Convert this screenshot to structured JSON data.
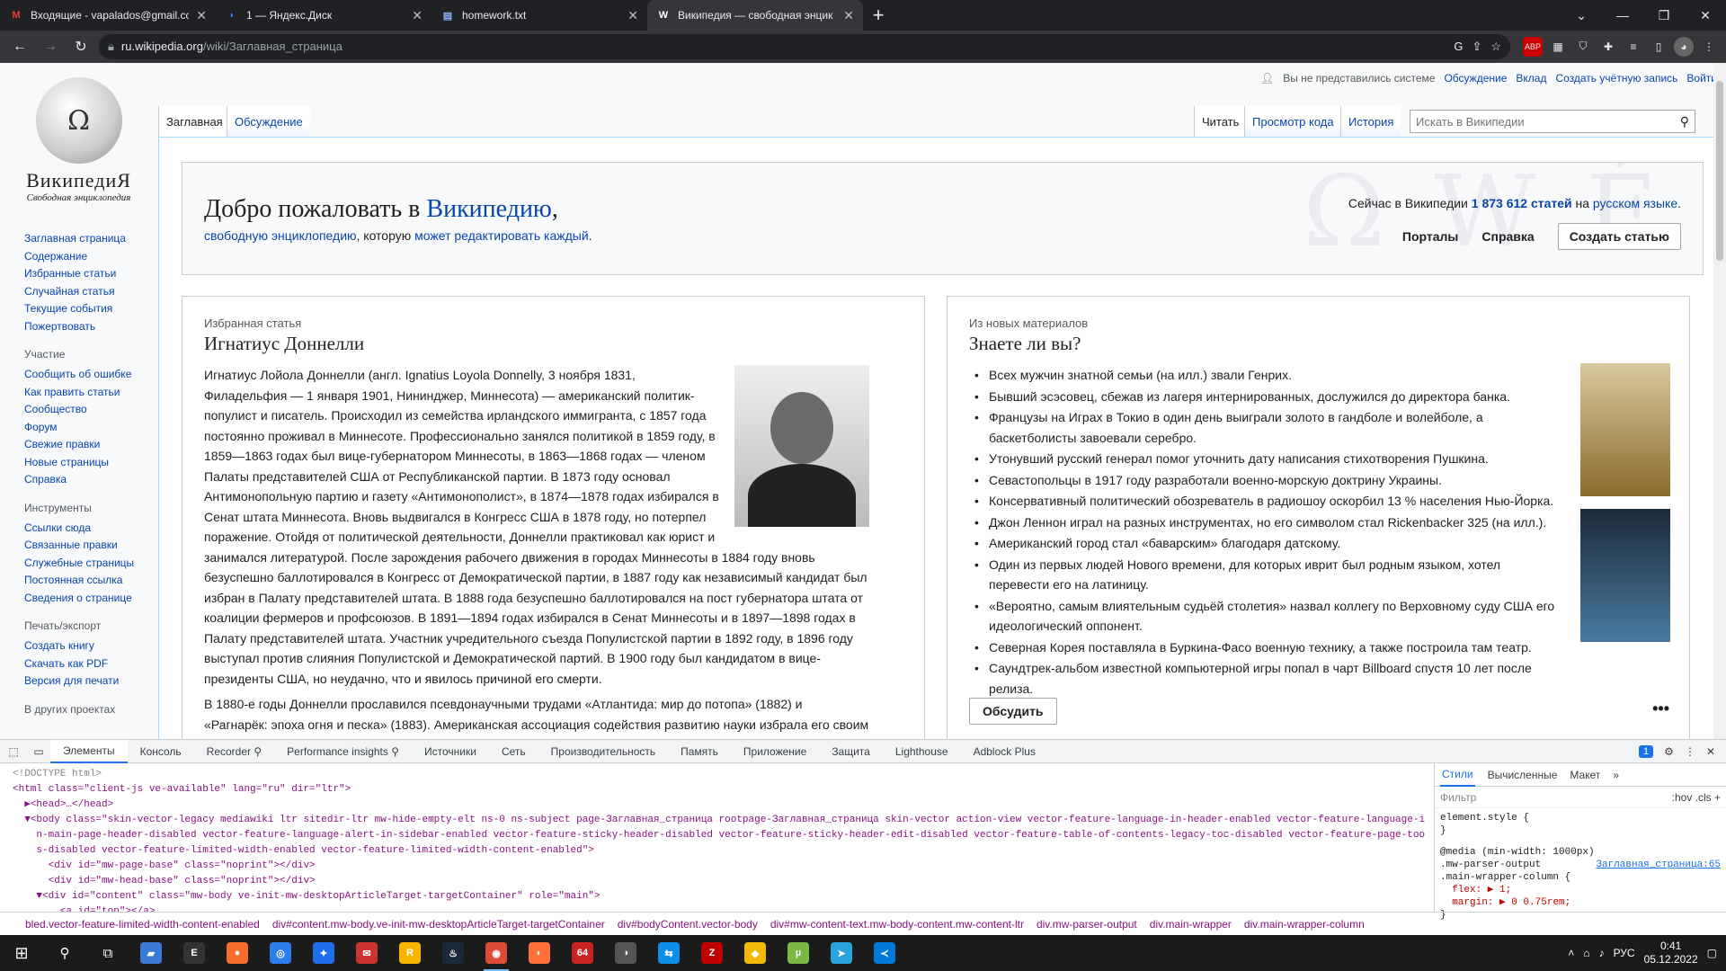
{
  "browser": {
    "tabs": [
      {
        "icon": "gmail-icon",
        "glyph": "M",
        "color": "#ea4335",
        "label": "Входящие - vapalados@gmail.co"
      },
      {
        "icon": "yandex-disk-icon",
        "glyph": "◗",
        "color": "#2f7cf6",
        "label": "1 — Яндекс.Диск"
      },
      {
        "icon": "text-file-icon",
        "glyph": "▤",
        "color": "#8ab4f8",
        "label": "homework.txt"
      },
      {
        "icon": "wikipedia-icon",
        "glyph": "W",
        "color": "#ffffff",
        "label": "Википедия — свободная энцик"
      }
    ],
    "url_host": "ru.wikipedia.org",
    "url_path": "/wiki/Заглавная_страница"
  },
  "wiki": {
    "wordmark": "ВикипедиЯ",
    "tagline": "Свободная энциклопедия",
    "personal": {
      "anon": "Вы не представились системе",
      "links": [
        "Обсуждение",
        "Вклад",
        "Создать учётную запись",
        "Войти"
      ]
    },
    "nav_main": [
      "Заглавная страница",
      "Содержание",
      "Избранные статьи",
      "Случайная статья",
      "Текущие события",
      "Пожертвовать"
    ],
    "nav_participation_head": "Участие",
    "nav_participation": [
      "Сообщить об ошибке",
      "Как править статьи",
      "Сообщество",
      "Форум",
      "Свежие правки",
      "Новые страницы",
      "Справка"
    ],
    "nav_tools_head": "Инструменты",
    "nav_tools": [
      "Ссылки сюда",
      "Связанные правки",
      "Служебные страницы",
      "Постоянная ссылка",
      "Сведения о странице"
    ],
    "nav_print_head": "Печать/экспорт",
    "nav_print": [
      "Создать книгу",
      "Скачать как PDF",
      "Версия для печати"
    ],
    "nav_other_head": "В других проектах",
    "tab_main": "Заглавная",
    "tab_talk": "Обсуждение",
    "tab_read": "Читать",
    "tab_source": "Просмотр кода",
    "tab_history": "История",
    "search_placeholder": "Искать в Википедии",
    "welcome": {
      "title_prefix": "Добро пожаловать в ",
      "title_link": "Википедию",
      "title_suffix": ",",
      "sub_link1": "свободную энциклопедию",
      "sub_mid": ", которую ",
      "sub_link2": "может редактировать каждый",
      "sub_end": ".",
      "stats_prefix": "Сейчас в Википедии ",
      "stats_count": "1 873 612 статей",
      "stats_mid": " на ",
      "stats_lang": "русском языке",
      "stats_end": ".",
      "portals": "Порталы",
      "help": "Справка",
      "create": "Создать статью"
    },
    "featured": {
      "kicker": "Избранная статья",
      "title": "Игнатиус Доннелли",
      "p1": "Игнатиус Лойола Доннелли (англ. Ignatius Loyola Donnelly, 3 ноября 1831, Филадельфия — 1 января 1901, Нининджер, Миннесота) — американский политик-популист и писатель. Происходил из семейства ирландского иммигранта, с 1857 года постоянно проживал в Миннесоте. Профессионально занялся политикой в 1859 году, в 1859—1863 годах был вице-губернатором Миннесоты, в 1863—1868 годах — членом Палаты представителей США от Республиканской партии. В 1873 году основал Антимонопольную партию и газету «Антимонополист», в 1874—1878 годах избирался в Сенат штата Миннесота. Вновь выдвигался в Конгресс США в 1878 году, но потерпел поражение. Отойдя от политической деятельности, Доннелли практиковал как юрист и занимался литературой. После зарождения рабочего движения в городах Миннесоты в 1884 году вновь безуспешно баллотировался в Конгресс от Демократической партии, в 1887 году как независимый кандидат был избран в Палату представителей штата. В 1888 года безуспешно баллотировался на пост губернатора штата от коалиции фермеров и профсоюзов. В 1891—1894 годах избирался в Сенат Миннесоты и в 1897—1898 годах в Палату представителей штата. Участник учредительного съезда Популистской партии в 1892 году, в 1896 году выступал против слияния Популистской и Демократической партий. В 1900 году был кандидатом в вице-президенты США, но неудачно, что и явилось причиной его смерти.",
      "p2": "В 1880-е годы Доннелли прославился псевдонаучными трудами «Атлантида: мир до потопа» (1882) и «Рагнарёк: эпоха огня и песка» (1883). Американская ассоциация содействия развитию науки избрала его своим действительным членом. Далее Доннелли обратился к шекспировскому вопросу, опубликовав «Великую"
    },
    "dyk": {
      "kicker": "Из новых материалов",
      "title": "Знаете ли вы?",
      "items": [
        "Всех мужчин знатной семьи (на илл.) звали Генрих.",
        "Бывший эсэсовец, сбежав из лагеря интернированных, дослужился до директора банка.",
        "Французы на Играх в Токио в один день выиграли золото в гандболе и волейболе, а баскетболисты завоевали серебро.",
        "Утонувший русский генерал помог уточнить дату написания стихотворения Пушкина.",
        "Севастопольцы в 1917 году разработали военно-морскую доктрину Украины.",
        "Консервативный политический обозреватель в радиошоу оскорбил 13 % населения Нью-Йорка.",
        "Джон Леннон играл на разных инструментах, но его символом стал Rickenbacker 325 (на илл.).",
        "Американский город стал «баварским» благодаря датскому.",
        "Один из первых людей Нового времени, для которых иврит был родным языком, хотел перевести его на латиницу.",
        "«Вероятно, самым влиятельным судьёй столетия» назвал коллегу по Верховному суду США его идеологический оппонент.",
        "Северная Корея поставляла в Буркина-Фасо военную технику, а также построила там театр.",
        "Саундтрек-альбом известной компьютерной игры попал в чарт Billboard спустя 10 лет после релиза."
      ],
      "discuss": "Обсудить",
      "more": "•••"
    }
  },
  "devtools": {
    "tabs": [
      "Элементы",
      "Консоль",
      "Recorder ⚲",
      "Performance insights ⚲",
      "Источники",
      "Сеть",
      "Производительность",
      "Память",
      "Приложение",
      "Защита",
      "Lighthouse",
      "Adblock Plus"
    ],
    "issues_badge": "1",
    "dom_lines": [
      "<!DOCTYPE html>",
      "<html class=\"client-js ve-available\" lang=\"ru\" dir=\"ltr\">",
      "  ▶<head>…</head>",
      "  ▼<body class=\"skin-vector-legacy mediawiki ltr sitedir-ltr mw-hide-empty-elt ns-0 ns-subject page-Заглавная_страница rootpage-Заглавная_страница skin-vector action-view vector-feature-language-in-header-enabled vector-feature-language-i",
      "    n-main-page-header-disabled vector-feature-language-alert-in-sidebar-enabled vector-feature-sticky-header-disabled vector-feature-sticky-header-edit-disabled vector-feature-table-of-contents-legacy-toc-disabled vector-feature-page-tool",
      "    s-disabled vector-feature-limited-width-enabled vector-feature-limited-width-content-enabled\">",
      "      <div id=\"mw-page-base\" class=\"noprint\"></div>",
      "      <div id=\"mw-head-base\" class=\"noprint\"></div>",
      "    ▼<div id=\"content\" class=\"mw-body ve-init-mw-desktopArticleTarget-targetContainer\" role=\"main\">",
      "        <a id=\"top\"></a>"
    ],
    "styles_tabs": [
      "Стили",
      "Вычисленные",
      "Макет"
    ],
    "filter_placeholder": "Фильтр",
    "filter_tools": ":hov  .cls  +",
    "rules": [
      "element.style {",
      "}",
      "@media (min-width: 1000px)",
      ".mw-parser-output",
      ".main-wrapper-column {",
      "  flex: ▶ 1;",
      "  margin: ▶ 0 0.75rem;",
      "}"
    ],
    "rule_source": "Заглавная_страница:65",
    "crumbs": [
      "bled.vector-feature-limited-width-content-enabled",
      "div#content.mw-body.ve-init-mw-desktopArticleTarget-targetContainer",
      "div#bodyContent.vector-body",
      "div#mw-content-text.mw-body-content.mw-content-ltr",
      "div.mw-parser-output",
      "div.main-wrapper",
      "div.main-wrapper-column"
    ]
  },
  "taskbar": {
    "apps": [
      {
        "name": "explorer-app-icon",
        "glyph": "▰",
        "color": "#3a7bd5"
      },
      {
        "name": "epic-games-app-icon",
        "glyph": "E",
        "color": "#333333"
      },
      {
        "name": "origin-app-icon",
        "glyph": "●",
        "color": "#f56c2d"
      },
      {
        "name": "uplay-app-icon",
        "glyph": "◎",
        "color": "#2b7de9"
      },
      {
        "name": "battlenet-app-icon",
        "glyph": "✦",
        "color": "#1d6ee8"
      },
      {
        "name": "mail-app-icon",
        "glyph": "✉",
        "color": "#cc3333"
      },
      {
        "name": "rockstar-app-icon",
        "glyph": "R",
        "color": "#f7b500"
      },
      {
        "name": "steam-app-icon",
        "glyph": "♨",
        "color": "#1b2838"
      },
      {
        "name": "chrome-app-icon",
        "glyph": "◉",
        "color": "#dd4b39"
      },
      {
        "name": "firefox-app-icon",
        "glyph": "◐",
        "color": "#ff7139"
      },
      {
        "name": "app-64-icon",
        "glyph": "64",
        "color": "#cc2222"
      },
      {
        "name": "gpu-app-icon",
        "glyph": "◑",
        "color": "#555555"
      },
      {
        "name": "teamviewer-app-icon",
        "glyph": "⇆",
        "color": "#0e8ee9"
      },
      {
        "name": "filezilla-app-icon",
        "glyph": "Z",
        "color": "#bf0000"
      },
      {
        "name": "binance-app-icon",
        "glyph": "◆",
        "color": "#f0b90b"
      },
      {
        "name": "utorrent-app-icon",
        "glyph": "µ",
        "color": "#78b843"
      },
      {
        "name": "telegram-app-icon",
        "glyph": "➤",
        "color": "#2aa3df"
      },
      {
        "name": "vscode-app-icon",
        "glyph": "≺",
        "color": "#0078d7"
      }
    ],
    "language": "РУС",
    "time": "0:41",
    "date": "05.12.2022"
  }
}
